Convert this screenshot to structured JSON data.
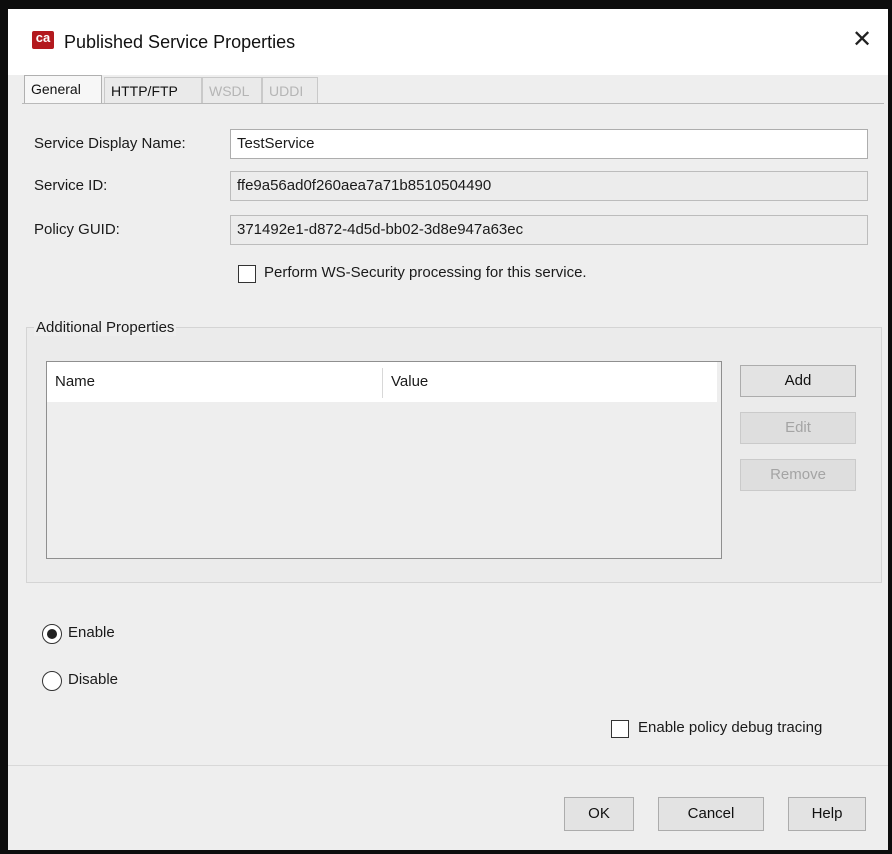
{
  "window": {
    "title": "Published Service Properties",
    "app_icon": "ca-logo-icon",
    "close_glyph": "✕"
  },
  "tabs": [
    {
      "label": "General",
      "state": "active"
    },
    {
      "label": "HTTP/FTP",
      "state": "enabled"
    },
    {
      "label": "WSDL",
      "state": "disabled"
    },
    {
      "label": "UDDI",
      "state": "disabled"
    }
  ],
  "general": {
    "display_name_label": "Service Display Name:",
    "display_name_value": "TestService",
    "service_id_label": "Service ID:",
    "service_id_value": "ffe9a56ad0f260aea7a71b8510504490",
    "policy_guid_label": "Policy GUID:",
    "policy_guid_value": "371492e1-d872-4d5d-bb02-3d8e947a63ec",
    "ws_security_label": "Perform WS-Security processing for this service.",
    "ws_security_checked": false
  },
  "additional_properties": {
    "title": "Additional Properties",
    "columns": [
      "Name",
      "Value"
    ],
    "rows": [],
    "add_label": "Add",
    "edit_label": "Edit",
    "remove_label": "Remove"
  },
  "status": {
    "enable_label": "Enable",
    "disable_label": "Disable",
    "selected": "Enable"
  },
  "debug": {
    "label": "Enable policy debug tracing",
    "checked": false
  },
  "footer": {
    "ok_label": "OK",
    "cancel_label": "Cancel",
    "help_label": "Help"
  },
  "colors": {
    "dialog_bg": "#eeeeee",
    "window_border": "#0d0d0d",
    "brand_red": "#b3191e"
  }
}
